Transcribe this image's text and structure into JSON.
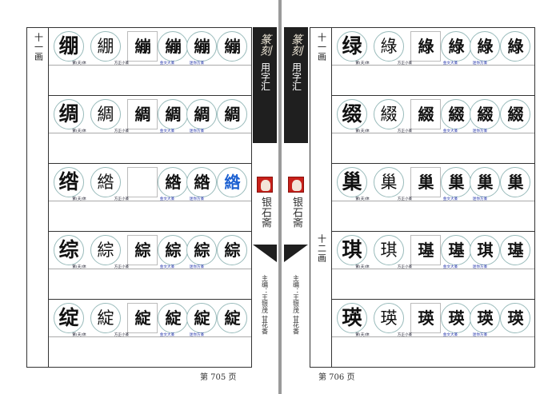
{
  "left_page": {
    "category": "十一画",
    "page_footer": "第 705 页",
    "rows": [
      {
        "glyphs": [
          "绷",
          "綳",
          "繃",
          "繃",
          "繃",
          "繃"
        ]
      },
      {
        "glyphs": [
          "绸",
          "綢",
          "綢",
          "綢",
          "綢",
          "綢"
        ]
      },
      {
        "glyphs": [
          "绺",
          "綹",
          "",
          "綹",
          "綹",
          "綹"
        ]
      },
      {
        "glyphs": [
          "综",
          "綜",
          "綜",
          "綜",
          "綜",
          "綜"
        ]
      },
      {
        "glyphs": [
          "绽",
          "綻",
          "綻",
          "綻",
          "綻",
          "綻"
        ]
      }
    ]
  },
  "right_page": {
    "category_1": "十一画",
    "category_2": "十二画",
    "page_footer": "第 706 页",
    "rows": [
      {
        "glyphs": [
          "绿",
          "綠",
          "綠",
          "綠",
          "綠",
          "綠"
        ]
      },
      {
        "glyphs": [
          "缀",
          "綴",
          "綴",
          "綴",
          "綴",
          "綴"
        ]
      },
      {
        "glyphs": [
          "巢",
          "巢",
          "巢",
          "巢",
          "巢",
          "巢"
        ]
      },
      {
        "glyphs": [
          "琪",
          "琪",
          "璂",
          "璂",
          "琪",
          "璂"
        ]
      },
      {
        "glyphs": [
          "瑛",
          "瑛",
          "瑛",
          "瑛",
          "瑛",
          "瑛"
        ]
      }
    ]
  },
  "captions": {
    "traditional": "繁(夫)体",
    "fangzheng": "方正小篆",
    "jinwen": "金文大篆",
    "jinhuai": "迷你方篆"
  },
  "spine": {
    "title_calligraphy": "篆刻",
    "subtitle": "用字汇",
    "publisher": "银石斋",
    "editors": "主编：王银茂 甘花香"
  },
  "colors": {
    "frame": "#333333",
    "blue_glyph": "#1a5fd1",
    "seal_red": "#c8201a"
  }
}
